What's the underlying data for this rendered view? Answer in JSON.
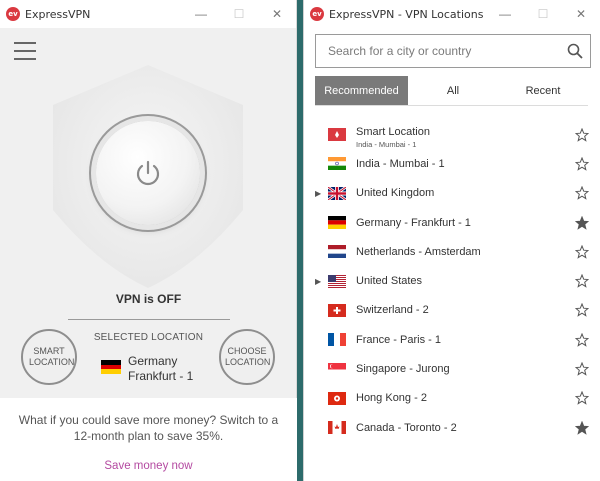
{
  "left_window": {
    "title": "ExpressVPN",
    "logo_text": "ev",
    "status": "VPN is OFF",
    "selected_label": "SELECTED LOCATION",
    "selected_country": "Germany",
    "selected_city": "Frankfurt - 1",
    "smart_button": "SMART LOCATION",
    "choose_button": "CHOOSE LOCATION",
    "promo_text": "What if you could save more money? Switch to a 12-month plan to save 35%.",
    "promo_link": "Save money now"
  },
  "right_window": {
    "title": "ExpressVPN - VPN Locations",
    "search_placeholder": "Search for a city or country",
    "tabs": [
      "Recommended",
      "All",
      "Recent"
    ],
    "active_tab": "Recommended",
    "locations": [
      {
        "name": "Smart Location",
        "sub": "India - Mumbai - 1",
        "flag": "smart",
        "expandable": false,
        "starred": false
      },
      {
        "name": "India - Mumbai - 1",
        "flag": "india",
        "expandable": false,
        "starred": false
      },
      {
        "name": "United Kingdom",
        "flag": "uk",
        "expandable": true,
        "starred": false
      },
      {
        "name": "Germany - Frankfurt - 1",
        "flag": "germany",
        "expandable": false,
        "starred": true
      },
      {
        "name": "Netherlands - Amsterdam",
        "flag": "netherlands",
        "expandable": false,
        "starred": false
      },
      {
        "name": "United States",
        "flag": "usa",
        "expandable": true,
        "starred": false
      },
      {
        "name": "Switzerland - 2",
        "flag": "switzerland",
        "expandable": false,
        "starred": false
      },
      {
        "name": "France - Paris - 1",
        "flag": "france",
        "expandable": false,
        "starred": false
      },
      {
        "name": "Singapore - Jurong",
        "flag": "singapore",
        "expandable": false,
        "starred": false
      },
      {
        "name": "Hong Kong - 2",
        "flag": "hongkong",
        "expandable": false,
        "starred": false
      },
      {
        "name": "Canada - Toronto - 2",
        "flag": "canada",
        "expandable": false,
        "starred": true
      }
    ]
  },
  "colors": {
    "brand_red": "#da3940",
    "promo_link": "#b44aa1",
    "active_tab": "#7a7a7a",
    "desktop": "#2d6b6b"
  }
}
